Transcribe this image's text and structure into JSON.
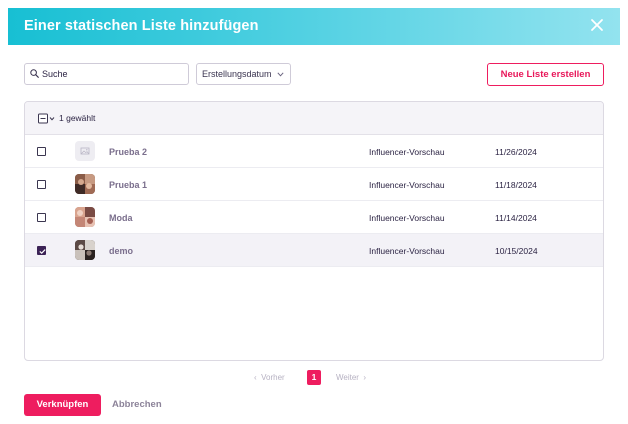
{
  "dialog": {
    "title": "Einer statischen Liste hinzufügen"
  },
  "toolbar": {
    "search_placeholder": "Suche",
    "sort_label": "Erstellungsdatum",
    "new_list_label": "Neue Liste erstellen"
  },
  "table": {
    "selection_count": "1 gewählt",
    "rows": [
      {
        "name": "Prueba 2",
        "type": "Influencer-Vorschau",
        "date": "11/26/2024",
        "checked": false,
        "avatar": "placeholder-image-icon"
      },
      {
        "name": "Prueba 1",
        "type": "Influencer-Vorschau",
        "date": "11/18/2024",
        "checked": false,
        "avatar": "photo-collage"
      },
      {
        "name": "Moda",
        "type": "Influencer-Vorschau",
        "date": "11/14/2024",
        "checked": false,
        "avatar": "photo-collage"
      },
      {
        "name": "demo",
        "type": "Influencer-Vorschau",
        "date": "10/15/2024",
        "checked": true,
        "avatar": "photo-collage"
      }
    ]
  },
  "pagination": {
    "prev_label": "Vorher",
    "current_page": "1",
    "next_label": "Weiter"
  },
  "footer": {
    "link_label": "Verknüpfen",
    "cancel_label": "Abbrechen"
  },
  "colors": {
    "header_gradient_start": "#17bfd3",
    "header_gradient_end": "#93e3ef",
    "accent": "#ee1d5f",
    "checked_box": "#3b2255",
    "list_name_text": "#7a6e8c"
  }
}
